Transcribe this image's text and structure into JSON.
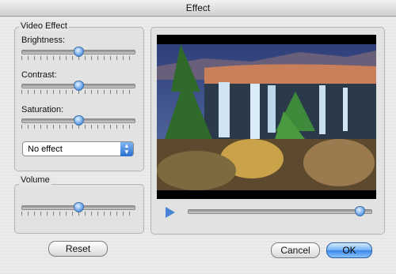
{
  "window": {
    "title": "Effect"
  },
  "video_effect": {
    "title": "Video Effect",
    "brightness": {
      "label": "Brightness:",
      "level": 0.5
    },
    "contrast": {
      "label": "Contrast:",
      "level": 0.5
    },
    "saturation": {
      "label": "Saturation:",
      "level": 0.5
    },
    "effect_select": {
      "value": "No effect"
    }
  },
  "volume": {
    "title": "Volume",
    "level": 0.5
  },
  "player": {
    "position": 0.93
  },
  "buttons": {
    "reset": "Reset",
    "cancel": "Cancel",
    "ok": "OK"
  },
  "colors": {
    "accent": "#4a84d6",
    "knob": "#6aa6ea"
  }
}
